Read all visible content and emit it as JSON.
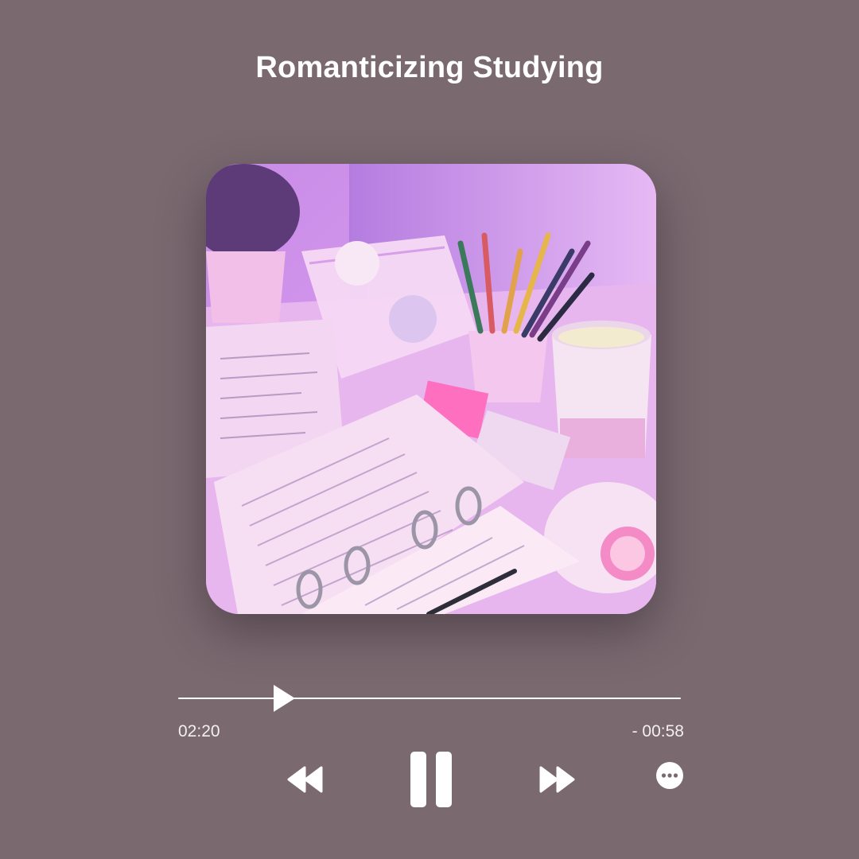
{
  "player": {
    "title": "Romanticizing Studying",
    "elapsed": "02:20",
    "remaining": "- 00:58",
    "progress_fraction": 0.19
  },
  "controls": {
    "rewind_icon": "rewind-icon",
    "pause_icon": "pause-icon",
    "fast_forward_icon": "fast-forward-icon",
    "more_icon": "more-options-icon"
  },
  "colors": {
    "background": "#7a6a70",
    "foreground": "#ffffff"
  }
}
